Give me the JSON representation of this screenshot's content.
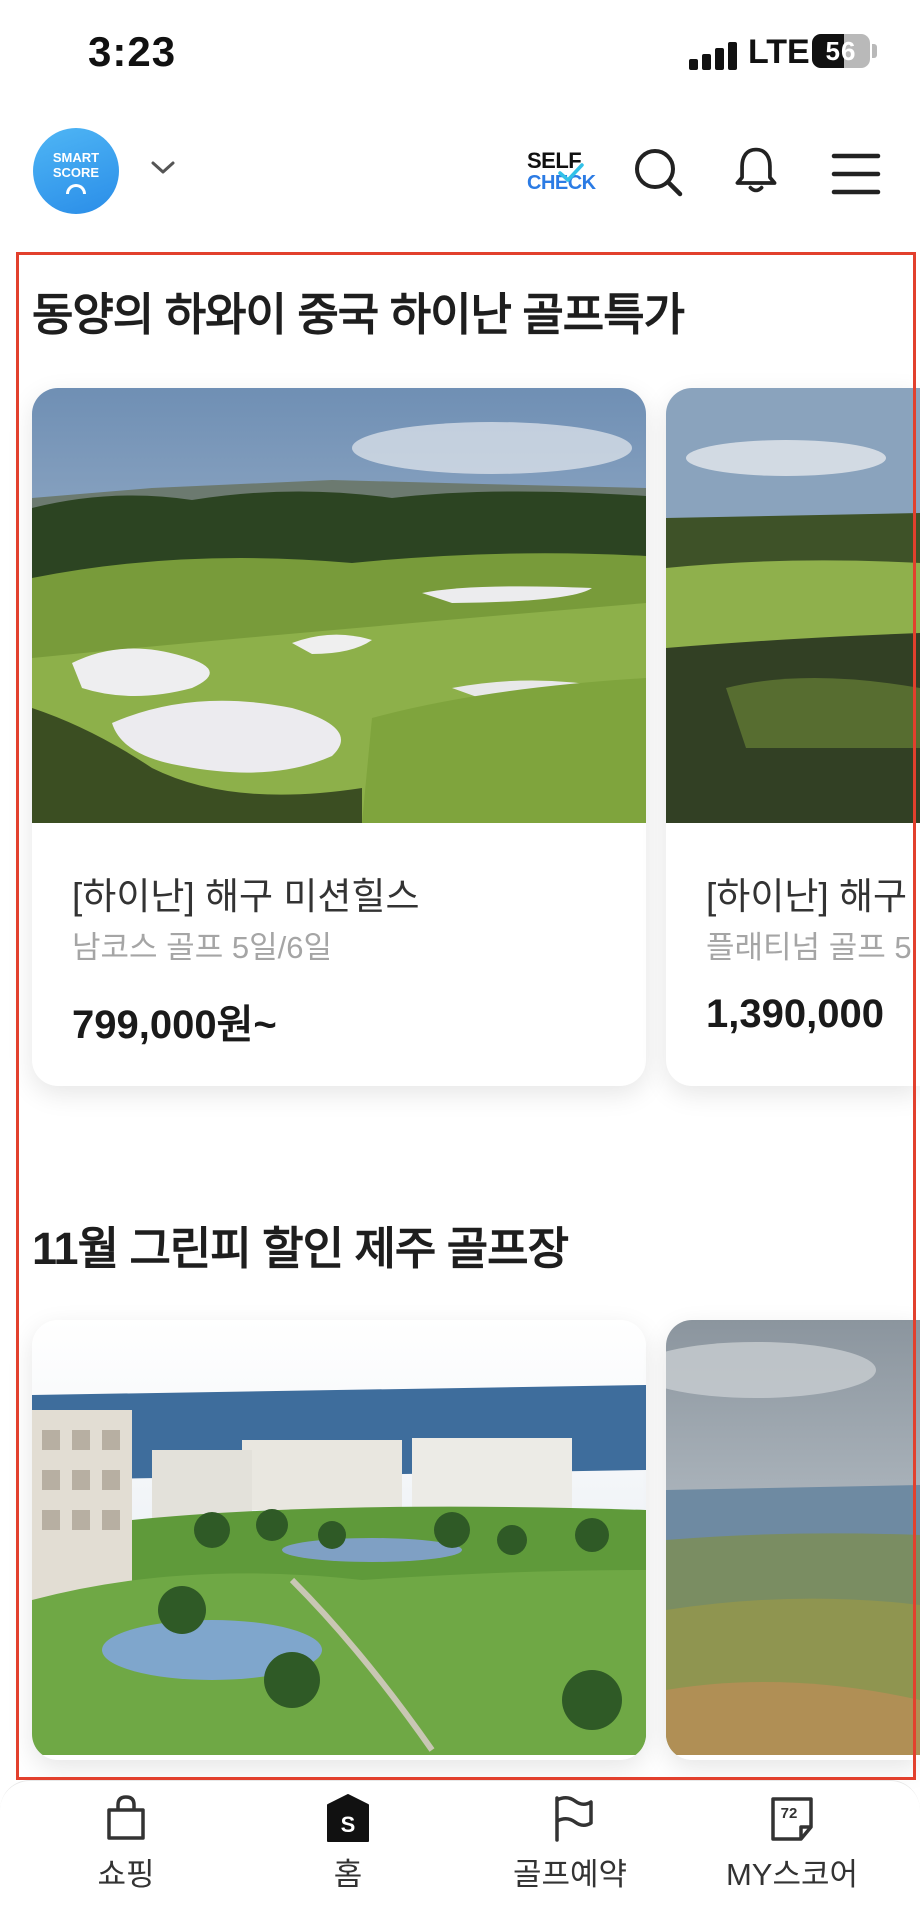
{
  "status_bar": {
    "time": "3:23",
    "network": "LTE",
    "battery": "56",
    "battery_level": 0.56
  },
  "header": {
    "logo_line1": "SMART",
    "logo_line2": "SCORE",
    "self_check_line1": "SELF",
    "self_check_line2": "CHECK"
  },
  "sections": [
    {
      "title": "동양의 하와이 중국 하이난 골프특가",
      "cards": [
        {
          "title": "[하이난] 해구 미션힐스",
          "subtitle": "남코스 골프 5일/6일",
          "price": "799,000원~"
        },
        {
          "title": "[하이난] 해구",
          "subtitle": "플래티넘 골프 5",
          "price": "1,390,000"
        }
      ]
    },
    {
      "title": "11월 그린피 할인 제주 골프장",
      "cards": [
        {
          "title": "",
          "subtitle": "",
          "price": ""
        },
        {
          "title": "",
          "subtitle": "",
          "price": ""
        }
      ]
    }
  ],
  "tab_bar": {
    "items": [
      {
        "label": "쇼핑",
        "icon": "shopping-bag-icon"
      },
      {
        "label": "홈",
        "icon": "home-s-icon",
        "icon_text": "S"
      },
      {
        "label": "골프예약",
        "icon": "golf-flag-icon"
      },
      {
        "label": "MY스코어",
        "icon": "score-card-icon",
        "icon_text": "72"
      }
    ]
  },
  "colors": {
    "accent": "#2b7be4",
    "highlight_frame": "#e2402d",
    "logo": "#3aa3ef"
  }
}
